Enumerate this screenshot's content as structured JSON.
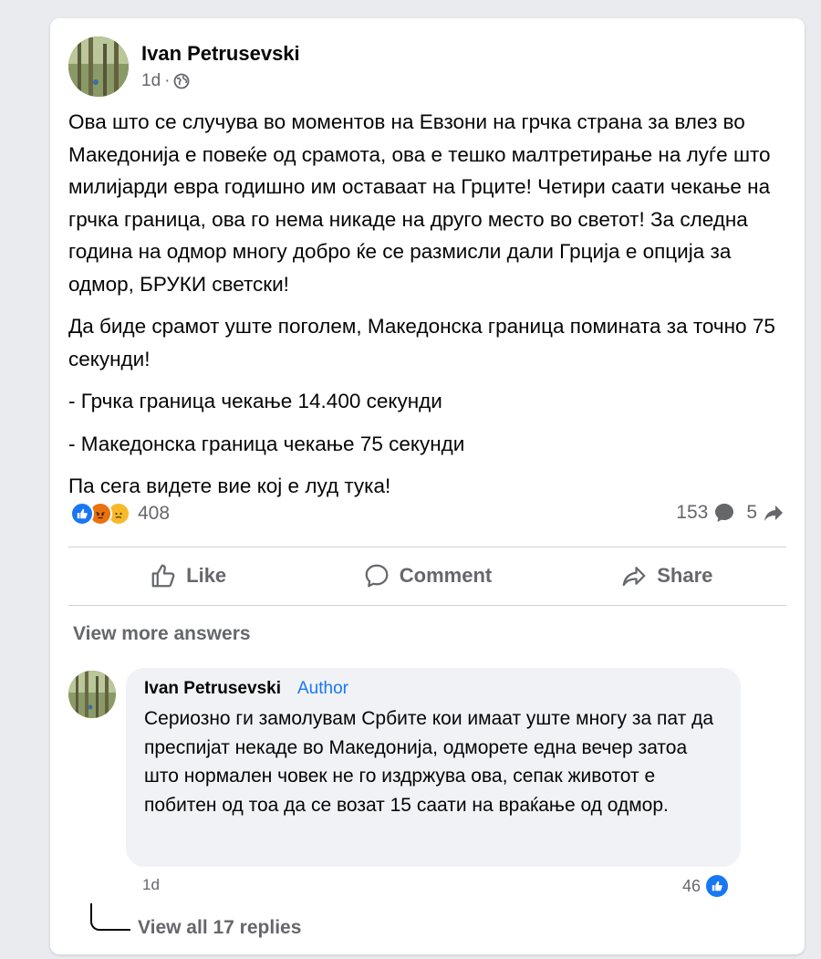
{
  "post": {
    "author": "Ivan Petrusevski",
    "time": "1d",
    "separator": "·",
    "paragraphs": [
      "Ова што се случува во моментов на Евзони на грчка страна за влез во Македонија е повеќе од срамота, ова е тешко малтретирање на луѓе што милијарди евра годишно им оставаат на Грците! Четири саати чекање на грчка граница, ова го нема никаде на друго место во светот! За следна година на одмор многу добро ќе се размисли дали Грција е опција за одмор, БРУКИ светски!",
      "Да биде срамот уште поголем, Македонска граница помината за точно 75 секунди!",
      "- Грчка граница чекање 14.400 секунди",
      "- Македонска граница чекање 75 секунди",
      "Па сега видете вие кој е луд тука!"
    ],
    "reaction_count": "408",
    "comment_count": "153",
    "share_count": "5"
  },
  "actions": {
    "like": "Like",
    "comment": "Comment",
    "share": "Share"
  },
  "comments": {
    "view_more": "View more answers",
    "author": "Ivan Petrusevski",
    "badge": "Author",
    "text": "Сериозно ги замолувам Србите кои имаат уште многу за пат да преспијат некаде во Македонија, одморете една вечер затоа што нормален човек не го издржува ова, сепак животот е побитен од тоа да се возат 15 саати на враќање од одмор.",
    "time": "1d",
    "likes": "46",
    "view_replies": "View all 17 replies"
  },
  "icons": {
    "privacy": "globe-icon",
    "reactions": [
      "like-reaction-icon",
      "angry-reaction-icon",
      "sad-reaction-icon"
    ],
    "comment_stat": "comment-bubble-icon",
    "share_stat": "share-arrow-icon"
  },
  "colors": {
    "accent": "#1877f2",
    "secondary_text": "#65676b",
    "bubble_bg": "#f0f2f5"
  }
}
